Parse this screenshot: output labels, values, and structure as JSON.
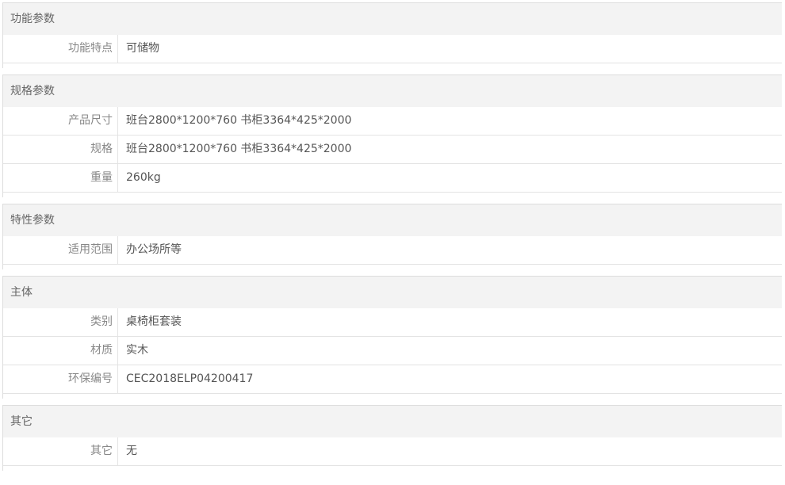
{
  "groups": [
    {
      "title": "功能参数",
      "rows": [
        {
          "label": "功能特点",
          "value": "可储物"
        }
      ]
    },
    {
      "title": "规格参数",
      "rows": [
        {
          "label": "产品尺寸",
          "value": "班台2800*1200*760 书柜3364*425*2000"
        },
        {
          "label": "规格",
          "value": "班台2800*1200*760 书柜3364*425*2000"
        },
        {
          "label": "重量",
          "value": "260kg"
        }
      ]
    },
    {
      "title": "特性参数",
      "rows": [
        {
          "label": "适用范围",
          "value": "办公场所等"
        }
      ]
    },
    {
      "title": "主体",
      "rows": [
        {
          "label": "类别",
          "value": "桌椅柜套装"
        },
        {
          "label": "材质",
          "value": "实木"
        },
        {
          "label": "环保编号",
          "value": "CEC2018ELP04200417"
        }
      ]
    },
    {
      "title": "其它",
      "rows": [
        {
          "label": "其它",
          "value": "无"
        }
      ]
    }
  ]
}
